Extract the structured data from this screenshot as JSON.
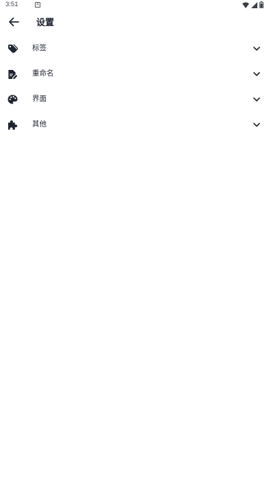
{
  "status_bar": {
    "time": "3:51",
    "notification_icon": "A",
    "icons": [
      "wifi-icon",
      "signal-icon",
      "battery-icon"
    ]
  },
  "app_bar": {
    "back_icon": "arrow-back-icon",
    "title": "设置"
  },
  "settings": {
    "items": [
      {
        "label": "标签",
        "icon": "tag-icon"
      },
      {
        "label": "重命名",
        "icon": "rename-icon"
      },
      {
        "label": "界面",
        "icon": "palette-icon"
      },
      {
        "label": "其他",
        "icon": "puzzle-icon"
      }
    ],
    "expand_icon": "chevron-down-icon"
  },
  "colors": {
    "icon": "#1f2530",
    "text": "#1f2530",
    "background": "#ffffff"
  }
}
